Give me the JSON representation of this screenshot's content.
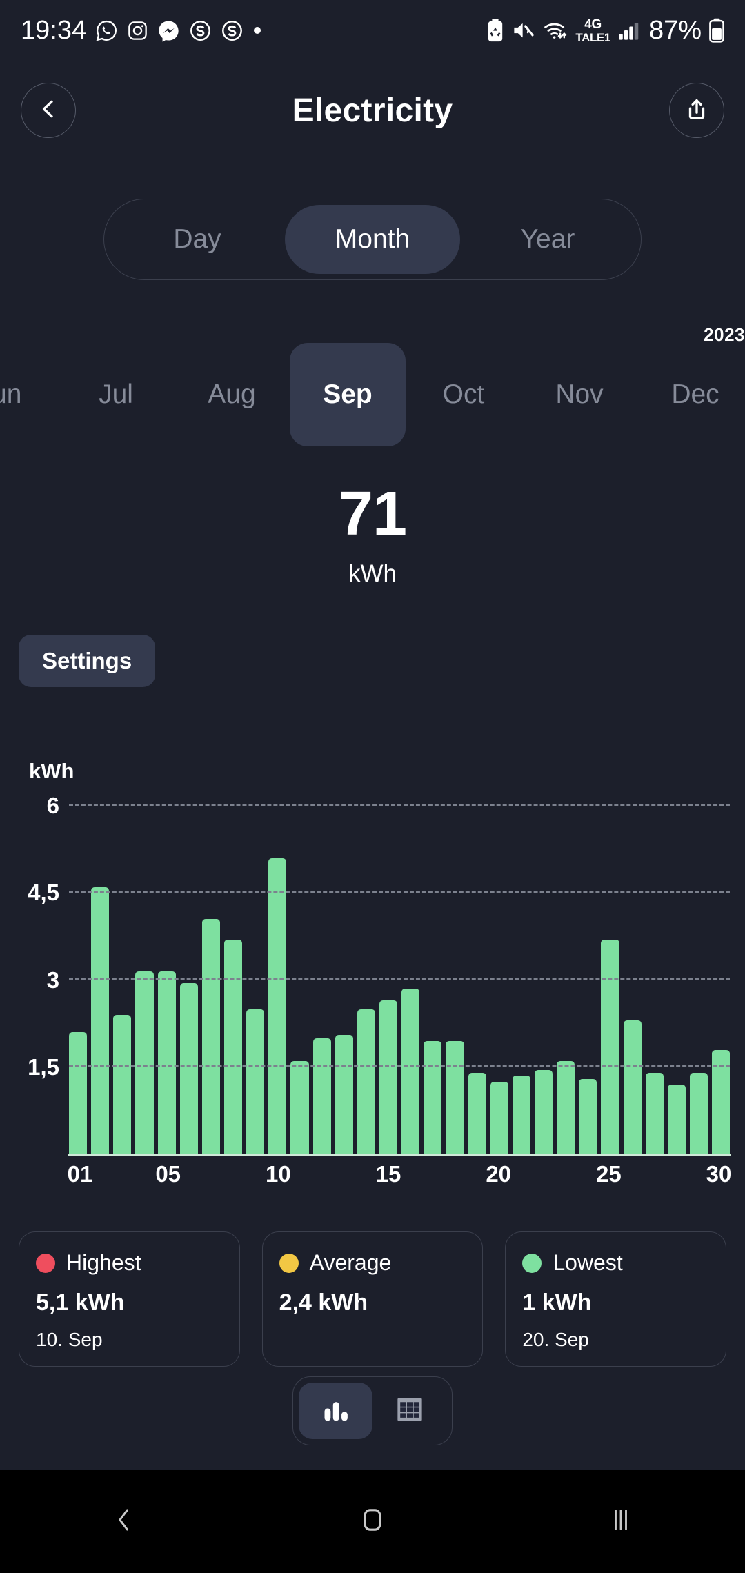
{
  "statusbar": {
    "time": "19:34",
    "battery_percent": "87%",
    "network_type": "4G",
    "carrier": "TALE1",
    "icons": [
      "whatsapp-icon",
      "instagram-icon",
      "messenger-icon",
      "skype-icon",
      "skype-icon",
      "dot-icon",
      "battery-saver-icon",
      "mute-icon",
      "wifi-icon",
      "signal-icon",
      "battery-icon"
    ]
  },
  "header": {
    "title": "Electricity",
    "back_icon": "chevron-left-icon",
    "share_icon": "share-icon"
  },
  "period_selector": {
    "options": [
      "Day",
      "Month",
      "Year"
    ],
    "selected": "Month"
  },
  "month_selector": {
    "year": "2023",
    "months": [
      "Jun",
      "Jul",
      "Aug",
      "Sep",
      "Oct",
      "Nov",
      "Dec"
    ],
    "selected": "Sep"
  },
  "total": {
    "value": "71",
    "unit": "kWh"
  },
  "settings": {
    "label": "Settings"
  },
  "chart_data": {
    "type": "bar",
    "title": "",
    "ylabel": "kWh",
    "xlabel": "",
    "ylim": [
      0,
      6
    ],
    "yticks": [
      6,
      4.5,
      3,
      1.5
    ],
    "ytick_labels": [
      "6",
      "4,5",
      "3",
      "1,5"
    ],
    "grid": true,
    "legend": "none",
    "bar_color": "#7ee0a0",
    "categories": [
      "01",
      "02",
      "03",
      "04",
      "05",
      "06",
      "07",
      "08",
      "09",
      "10",
      "11",
      "12",
      "13",
      "14",
      "15",
      "16",
      "17",
      "18",
      "19",
      "20",
      "21",
      "22",
      "23",
      "24",
      "25",
      "26",
      "27",
      "28",
      "29",
      "30"
    ],
    "xtick_labels": [
      "01",
      "05",
      "10",
      "15",
      "20",
      "25",
      "30"
    ],
    "values": [
      2.1,
      4.6,
      2.4,
      3.15,
      3.15,
      2.95,
      4.05,
      3.7,
      2.5,
      5.1,
      1.6,
      2.0,
      2.05,
      2.5,
      2.65,
      2.85,
      1.95,
      1.95,
      1.4,
      1.25,
      1.35,
      1.45,
      1.6,
      1.3,
      3.7,
      2.3,
      1.4,
      1.2,
      1.4,
      1.8
    ]
  },
  "stats": [
    {
      "label": "Highest",
      "value": "5,1 kWh",
      "date": "10. Sep",
      "color": "#ef4e5e"
    },
    {
      "label": "Average",
      "value": "2,4 kWh",
      "date": "",
      "color": "#f2c744"
    },
    {
      "label": "Lowest",
      "value": "1 kWh",
      "date": "20. Sep",
      "color": "#7ee0a0"
    }
  ],
  "view_toggle": {
    "options": [
      "bar-chart-icon",
      "table-grid-icon"
    ],
    "selected": "bar-chart-icon"
  },
  "navbar": {
    "back_icon": "nav-back-icon",
    "home_icon": "nav-home-icon",
    "recents_icon": "nav-recents-icon"
  },
  "colors": {
    "background": "#1c1f2b",
    "accent": "#7ee0a0",
    "surface": "#343a4e"
  }
}
